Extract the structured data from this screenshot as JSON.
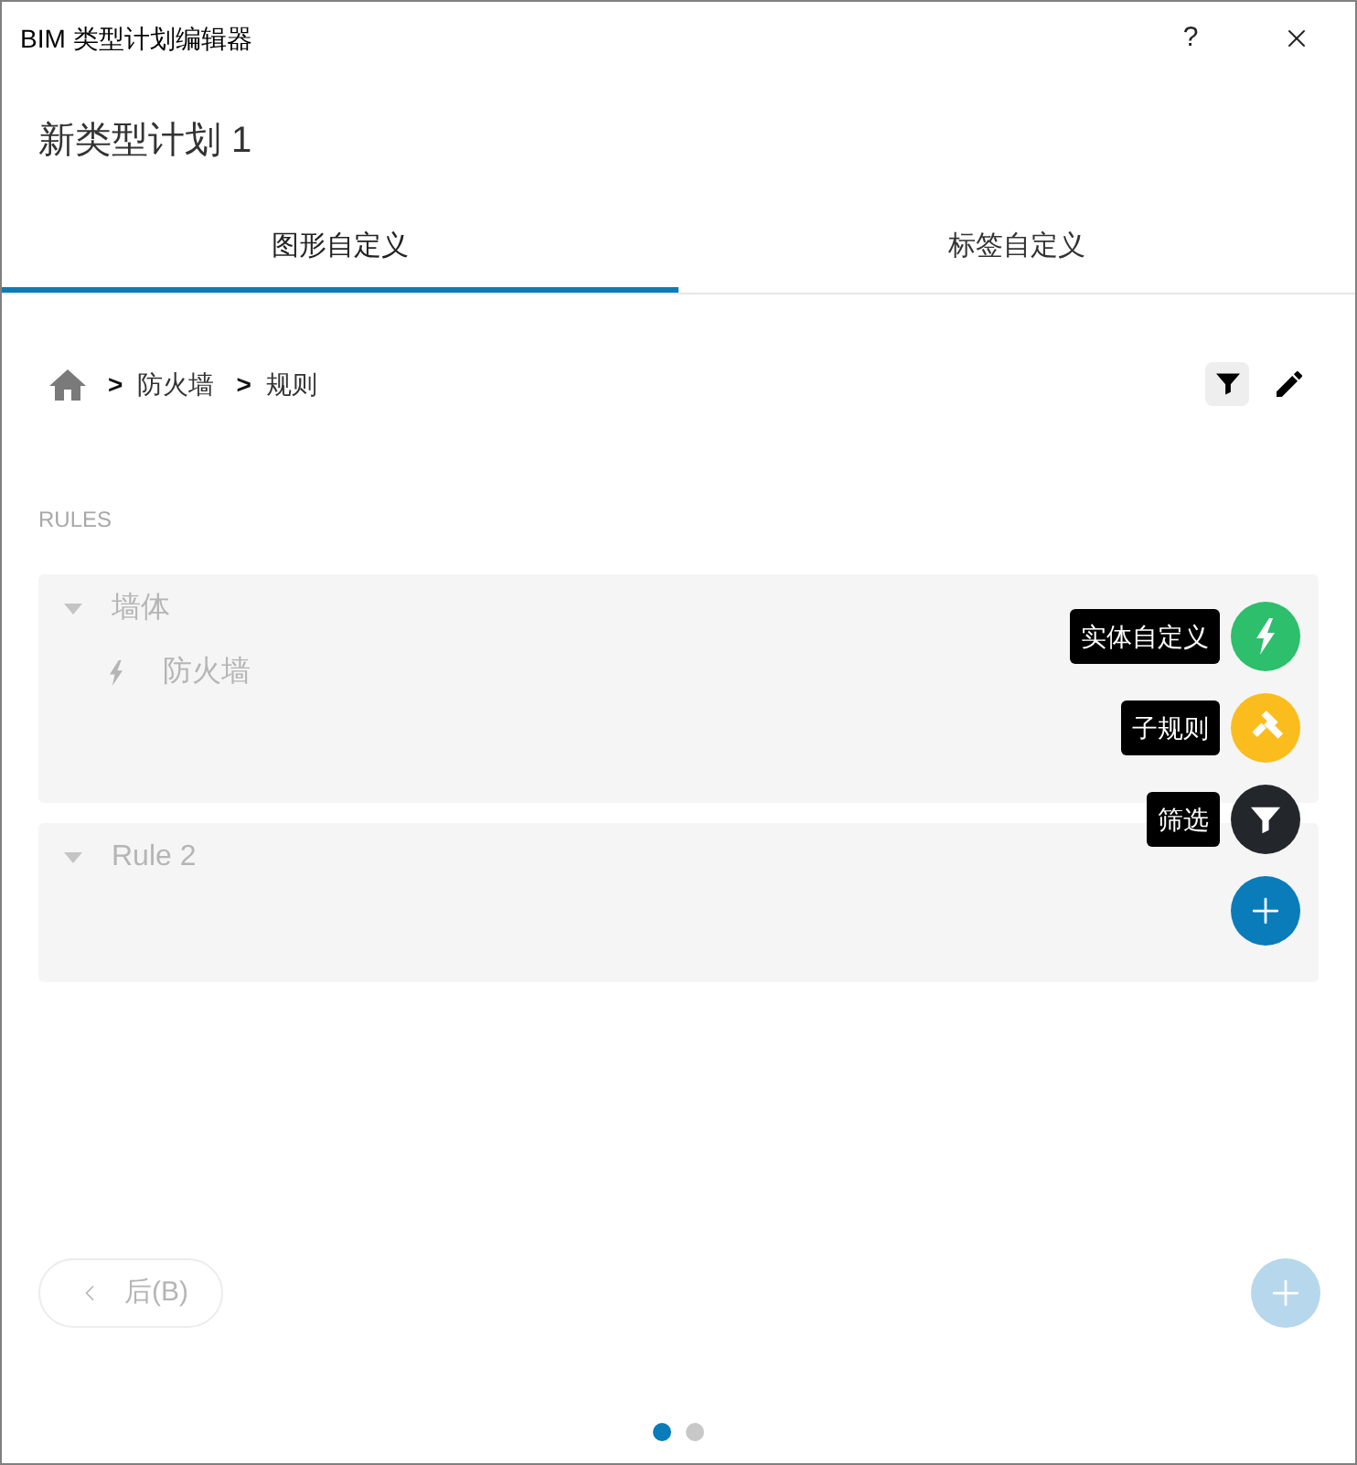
{
  "window": {
    "title": "BIM 类型计划编辑器",
    "help": "?"
  },
  "heading": "新类型计划 1",
  "tabs": [
    {
      "label": "图形自定义",
      "selected": true
    },
    {
      "label": "标签自定义",
      "selected": false
    }
  ],
  "breadcrumb": [
    {
      "separator": ">",
      "label": "防火墙"
    },
    {
      "separator": ">",
      "label": "规则"
    }
  ],
  "tools": [
    {
      "kind": "filter",
      "selected": true
    },
    {
      "kind": "edit",
      "selected": false
    }
  ],
  "rules_label": "RULES",
  "rules": [
    {
      "name": "墙体",
      "expanded": true,
      "children": [
        {
          "kind": "entity",
          "name": "防火墙"
        }
      ]
    },
    {
      "name": "Rule 2",
      "expanded": true
    }
  ],
  "speed_dial": {
    "open": true,
    "actions": [
      {
        "kind": "entity",
        "label": "实体自定义",
        "color": "#2dbf6b"
      },
      {
        "kind": "subrule",
        "label": "子规则",
        "color": "#fbbd1e"
      },
      {
        "kind": "filter",
        "label": "筛选",
        "color": "#23272b"
      }
    ]
  },
  "back_button": {
    "label": "后(B)",
    "disabled": true
  },
  "add_button": {
    "disabled": true
  },
  "pager": [
    {
      "selected": true
    },
    {
      "selected": false
    }
  ]
}
